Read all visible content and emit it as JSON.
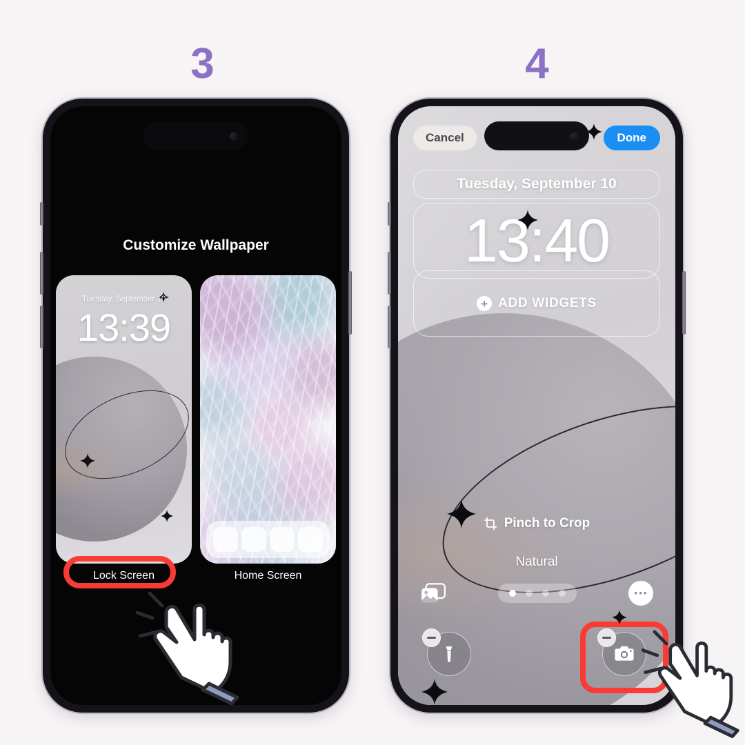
{
  "background_color": "#f7f4f6",
  "accent_purple": "#8b72c4",
  "highlight_red": "#f93b33",
  "steps": [
    {
      "number": "3"
    },
    {
      "number": "4"
    }
  ],
  "left_phone": {
    "screen_title": "Customize Wallpaper",
    "thumbnails": [
      {
        "kind": "lock-screen-preview",
        "date": "Tuesday, September 10",
        "time": "13:39",
        "label": "Lock Screen",
        "highlighted": true
      },
      {
        "kind": "home-screen-preview",
        "label": "Home Screen",
        "highlighted": false
      }
    ],
    "cursor": {
      "icon": "pointing-hand-cursor",
      "action": "tap"
    }
  },
  "right_phone": {
    "toolbar": {
      "cancel_label": "Cancel",
      "done_label": "Done"
    },
    "date_widget": "Tuesday, September 10",
    "clock": "13:40",
    "add_widgets_label": "ADD WIDGETS",
    "add_widgets_icon": "plus-circle-icon",
    "pinch_hint": "Pinch to Crop",
    "pinch_icon": "crop-icon",
    "style_name": "Natural",
    "photos_icon": "photos-library-icon",
    "more_icon": "ellipsis-icon",
    "style_dots": {
      "count": 4,
      "active_index": 0
    },
    "quick_actions": [
      {
        "icon": "flashlight-icon",
        "badge": "minus-badge",
        "highlighted": false
      },
      {
        "icon": "camera-icon",
        "badge": "minus-badge",
        "highlighted": true
      }
    ],
    "cursor": {
      "icon": "pointing-hand-cursor",
      "action": "tap"
    }
  }
}
